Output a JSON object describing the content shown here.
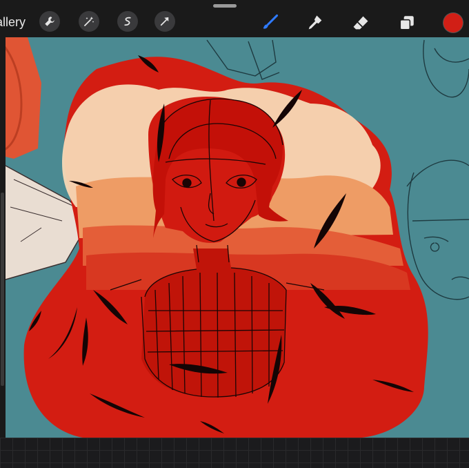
{
  "toolbar": {
    "gallery_label": "allery",
    "tools": {
      "wrench": "wrench-icon",
      "magic": "magic-wand-icon",
      "selection": "selection-icon",
      "transform": "transform-arrow-icon",
      "brush": "brush-icon",
      "smudge": "smudge-icon",
      "eraser": "eraser-icon",
      "layers": "layers-icon"
    },
    "active_tool": "brush",
    "current_color": "#d11f16"
  },
  "canvas": {
    "background_color": "#4b8a92",
    "artwork_primary_color": "#d11f16"
  }
}
